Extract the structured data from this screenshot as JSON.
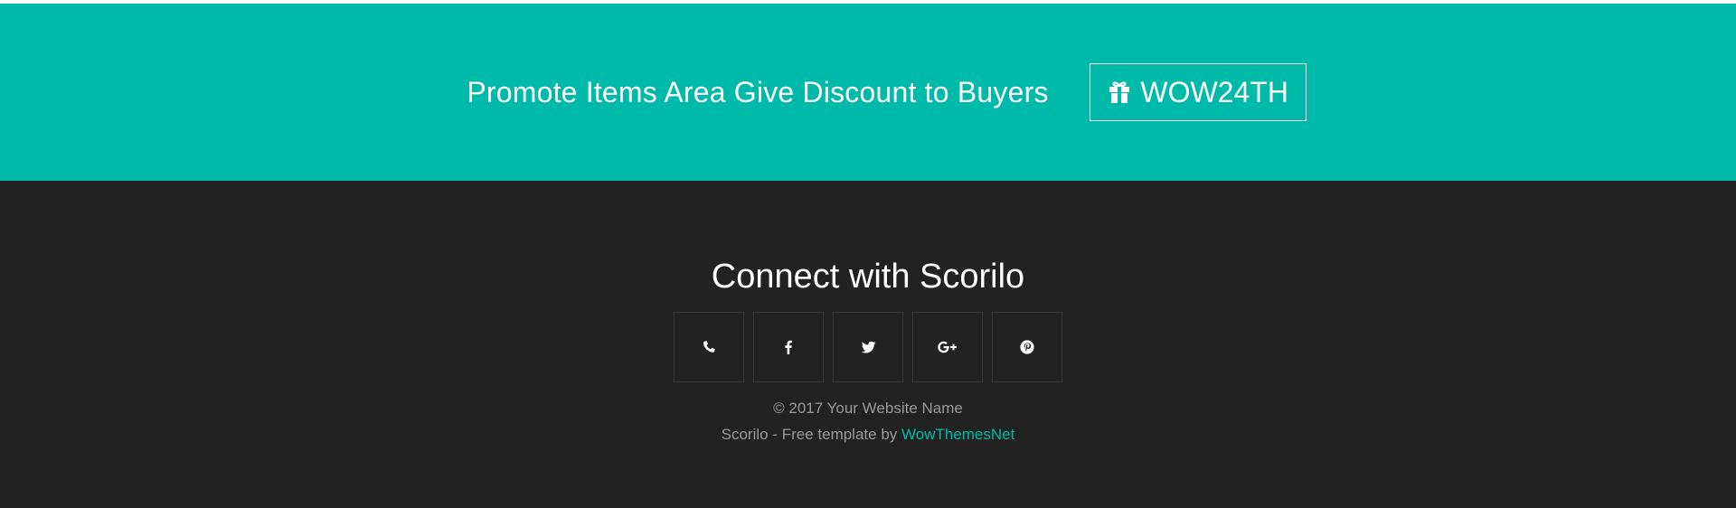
{
  "colors": {
    "accent": "#00baa9",
    "footer_bg": "#222222",
    "text_light": "#ffffff",
    "text_muted": "#9a9a9a"
  },
  "promo": {
    "text": "Promote Items Area Give Discount to Buyers",
    "coupon_code": "WOW24TH",
    "coupon_icon": "gift-icon"
  },
  "footer": {
    "title": "Connect with Scorilo",
    "social": [
      {
        "name": "phone",
        "icon": "phone-icon"
      },
      {
        "name": "facebook",
        "icon": "facebook-icon"
      },
      {
        "name": "twitter",
        "icon": "twitter-icon"
      },
      {
        "name": "google-plus",
        "icon": "google-plus-icon"
      },
      {
        "name": "pinterest",
        "icon": "pinterest-icon"
      }
    ],
    "copyright": "© 2017 Your Website Name",
    "credit_prefix": "Scorilo - Free template by ",
    "credit_link": "WowThemesNet"
  }
}
